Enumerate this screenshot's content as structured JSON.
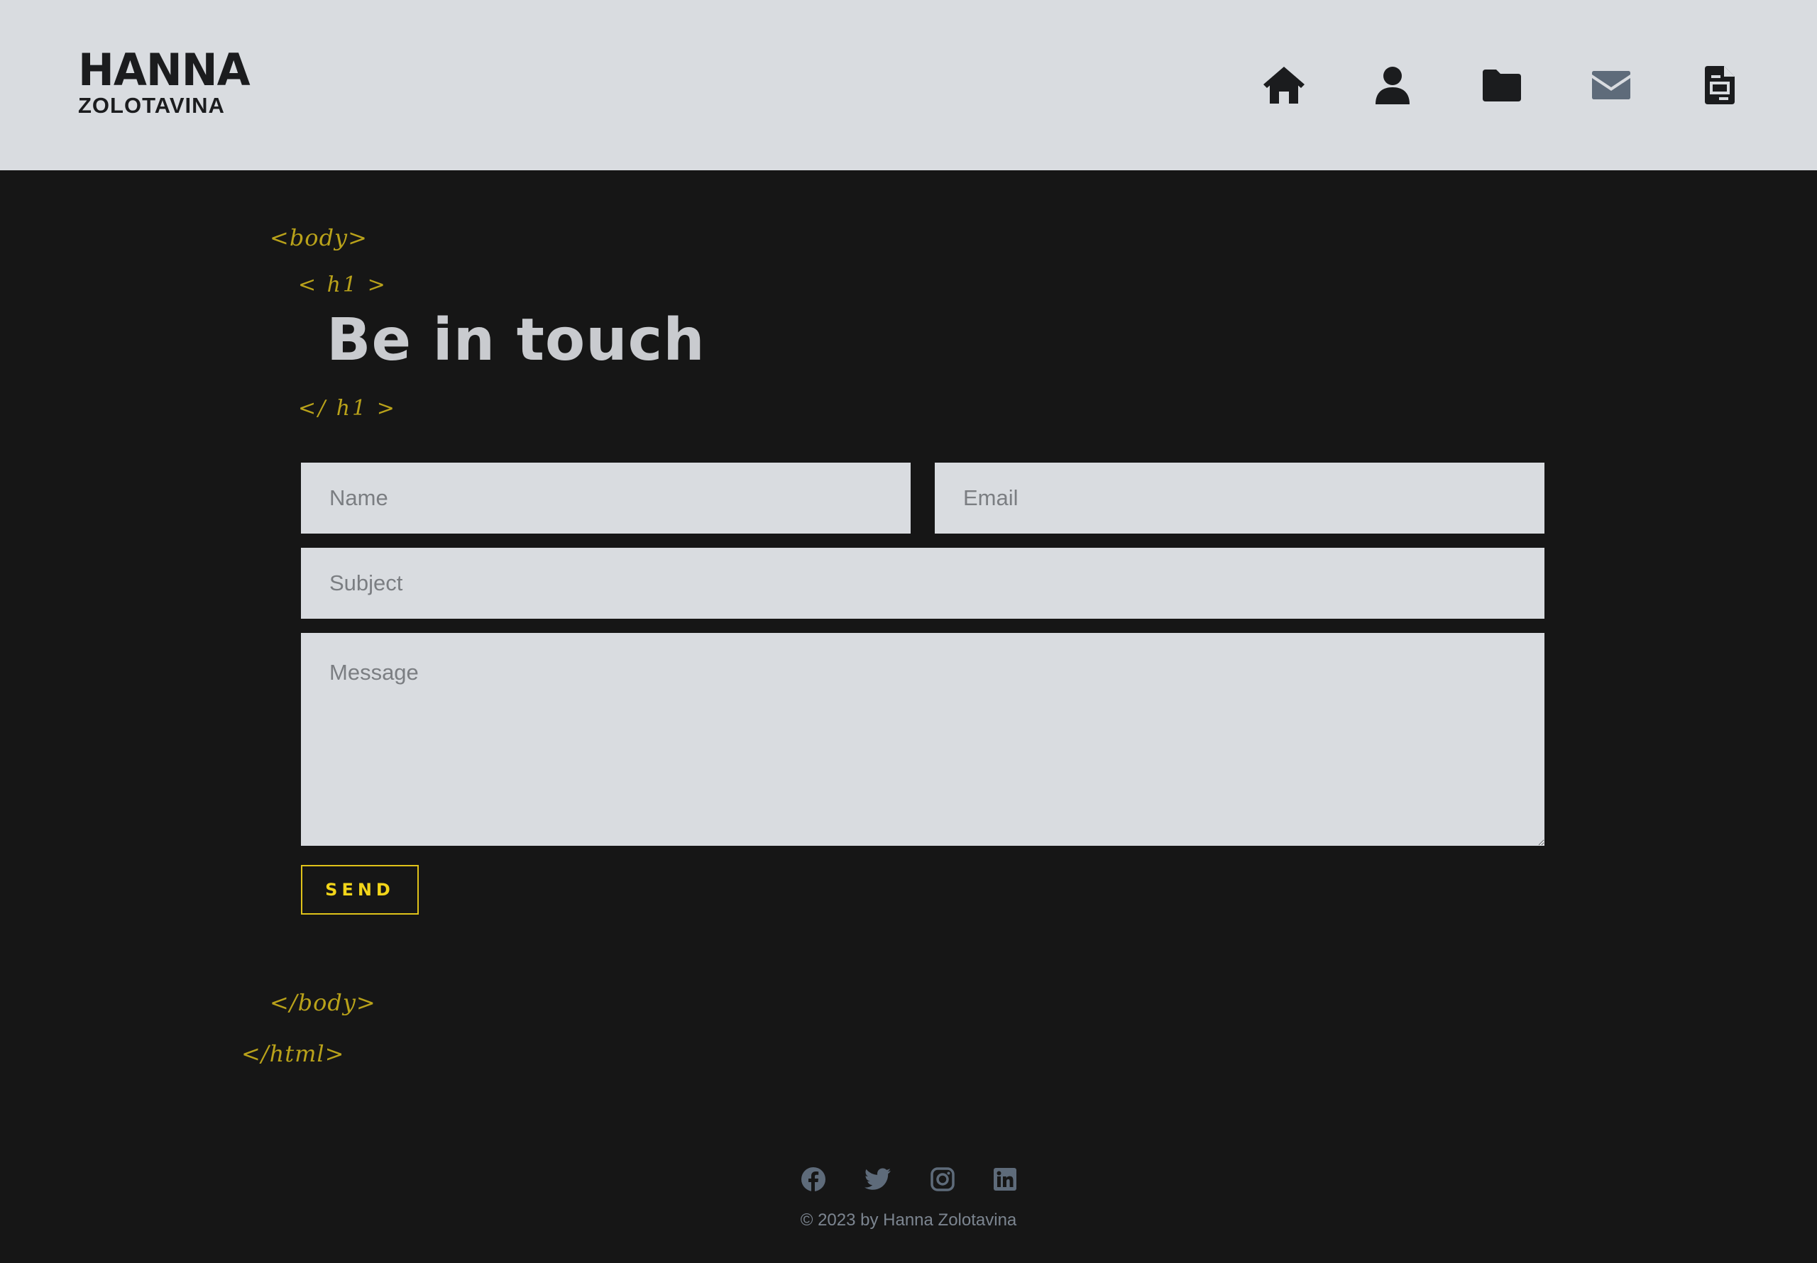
{
  "header": {
    "logo_top": "HANNA",
    "logo_bottom": "ZOLOTAVINA",
    "nav": [
      {
        "icon": "home-icon",
        "active": false
      },
      {
        "icon": "user-icon",
        "active": false
      },
      {
        "icon": "folder-icon",
        "active": false
      },
      {
        "icon": "envelope-icon",
        "active": true
      },
      {
        "icon": "document-icon",
        "active": false
      }
    ]
  },
  "decor": {
    "body_open": "<body>",
    "h1_open": "< h1 >",
    "h1_close": "</ h1 >",
    "body_close": "</body>",
    "html_close": "</html>"
  },
  "contact": {
    "title": "Be in touch",
    "name_placeholder": "Name",
    "email_placeholder": "Email",
    "subject_placeholder": "Subject",
    "message_placeholder": "Message",
    "send_label": "SEND"
  },
  "footer": {
    "socials": [
      "facebook-icon",
      "twitter-icon",
      "instagram-icon",
      "linkedin-icon"
    ],
    "copyright": "© 2023 by Hanna Zolotavina"
  },
  "colors": {
    "background": "#161616",
    "header_bg": "#d9dce0",
    "accent": "#e0c31a",
    "nav_active": "#5e6b7a",
    "icon_dark": "#1b1c1e"
  }
}
